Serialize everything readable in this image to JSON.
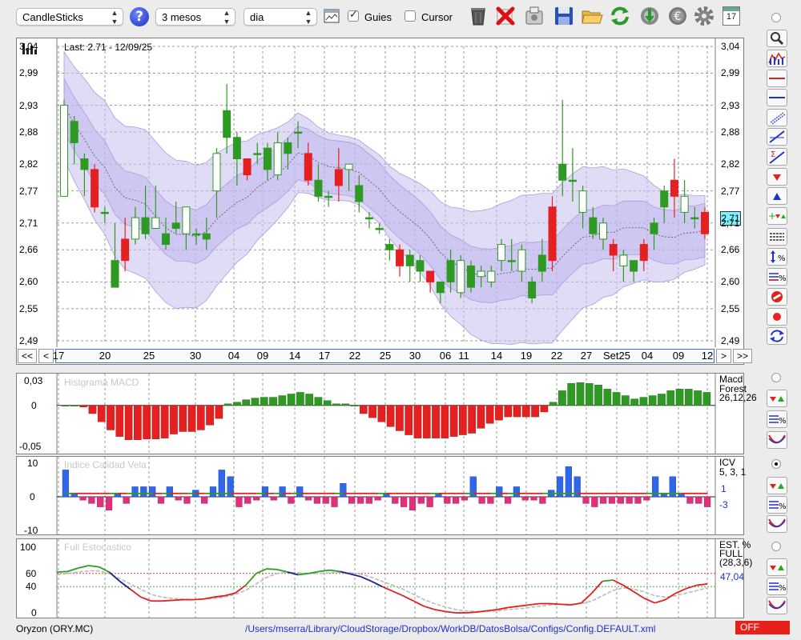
{
  "toolbar": {
    "chart_type": "CandleSticks",
    "period": "3 mesos",
    "interval": "dia",
    "guides_label": "Guies",
    "guides_checked": true,
    "cursor_label": "Cursor",
    "cursor_checked": false,
    "tools": [
      "help-icon",
      "window-icon",
      "trash-icon",
      "delete-x-icon",
      "ticker-tool-icon",
      "save-icon",
      "open-folder-icon",
      "refresh-icon",
      "download-icon",
      "currency-icon",
      "gear-icon",
      "calendar-icon"
    ],
    "calendar_day": "17"
  },
  "main_chart": {
    "last_label": "Last: 2.71 - 12/09/25",
    "current_price": "2,71",
    "y_ticks": [
      "3,04",
      "2,99",
      "2,93",
      "2,88",
      "2,82",
      "2,77",
      "2,71",
      "2,66",
      "2,60",
      "2,55",
      "2,49"
    ],
    "x_ticks": [
      "17",
      "20",
      "25",
      "30",
      "04",
      "09",
      "14",
      "17",
      "22",
      "25",
      "30",
      "06",
      "11",
      "14",
      "19",
      "22",
      "27",
      "Set25",
      "04",
      "09",
      "12"
    ],
    "nav": {
      "first": "<<",
      "prev": "<",
      "next": ">",
      "last": ">>"
    }
  },
  "macd": {
    "title": "Histgrama MACD",
    "y_ticks": [
      "0,03",
      "0",
      "-0,05"
    ],
    "label_line1": "Macd",
    "label_line2": "Forest",
    "label_line3": "26,12,26"
  },
  "icv": {
    "title": "Indice Calidad Vela",
    "y_ticks": [
      "10",
      "0",
      "-10"
    ],
    "label_line1": "ICV",
    "label_line2": "5, 3, 1",
    "value_pos": "1",
    "value_neg": "-3"
  },
  "stoch": {
    "title": "Full Estocastico",
    "y_ticks": [
      "100",
      "60",
      "40",
      "0"
    ],
    "label_line1": "EST. %",
    "label_line2": "FULL",
    "label_line3": "(28,3,6)",
    "value": "47,04"
  },
  "status": {
    "ticker": "Oryzon (ORY.MC)",
    "config_path": "/Users/mserra/Library/CloudStorage/Dropbox/WorkDB/DatosBolsa/Configs/Config.DEFAULT.xml",
    "off_label": "OFF"
  },
  "colors": {
    "up": "#2f9a23",
    "down": "#e52020",
    "band": "#c9c0ee",
    "accent": "#1f2fd0",
    "off_bg": "#e8201c"
  },
  "chart_data": [
    {
      "type": "candlestick",
      "y_range": [
        2.49,
        3.04
      ],
      "open": [
        2.76,
        2.9,
        2.83,
        2.81,
        2.73,
        2.64,
        2.68,
        2.68,
        2.72,
        2.7,
        2.69,
        2.71,
        2.69,
        2.69,
        2.69,
        2.77,
        2.92,
        2.87,
        2.83,
        2.84,
        2.85,
        2.8,
        2.86,
        2.88,
        2.84,
        2.79,
        2.76,
        2.81,
        2.81,
        2.78,
        2.72,
        2.7,
        2.67,
        2.66,
        2.65,
        2.64,
        2.62,
        2.6,
        2.64,
        2.58,
        2.63,
        2.61,
        2.6,
        2.64,
        2.64,
        2.62,
        2.6,
        2.65,
        2.74,
        2.82,
        2.79,
        2.73,
        2.72,
        2.68,
        2.67,
        2.63,
        2.64,
        2.67,
        2.71,
        2.77,
        2.79,
        2.73,
        2.72,
        2.73
      ],
      "close": [
        2.93,
        2.86,
        2.81,
        2.74,
        2.73,
        2.59,
        2.64,
        2.72,
        2.69,
        2.72,
        2.67,
        2.7,
        2.74,
        2.69,
        2.68,
        2.84,
        2.87,
        2.83,
        2.8,
        2.84,
        2.81,
        2.86,
        2.84,
        2.88,
        2.79,
        2.76,
        2.76,
        2.78,
        2.82,
        2.75,
        2.72,
        2.7,
        2.66,
        2.63,
        2.63,
        2.62,
        2.6,
        2.58,
        2.6,
        2.64,
        2.59,
        2.62,
        2.62,
        2.67,
        2.64,
        2.66,
        2.57,
        2.62,
        2.64,
        2.79,
        2.79,
        2.77,
        2.69,
        2.71,
        2.65,
        2.65,
        2.62,
        2.64,
        2.69,
        2.74,
        2.76,
        2.76,
        2.72,
        2.69
      ],
      "high": [
        2.94,
        2.91,
        2.84,
        2.82,
        2.74,
        2.71,
        2.72,
        2.74,
        2.78,
        2.78,
        2.72,
        2.75,
        2.74,
        2.7,
        2.72,
        2.85,
        2.97,
        2.88,
        2.83,
        2.86,
        2.86,
        2.88,
        2.87,
        2.9,
        2.86,
        2.82,
        2.77,
        2.85,
        2.82,
        2.8,
        2.73,
        2.71,
        2.68,
        2.67,
        2.66,
        2.65,
        2.62,
        2.6,
        2.66,
        2.65,
        2.64,
        2.63,
        2.63,
        2.68,
        2.68,
        2.67,
        2.61,
        2.68,
        2.76,
        2.94,
        2.85,
        2.78,
        2.74,
        2.72,
        2.68,
        2.66,
        2.64,
        2.68,
        2.72,
        2.78,
        2.83,
        2.79,
        2.74,
        2.74
      ],
      "low": [
        2.76,
        2.82,
        2.76,
        2.73,
        2.71,
        2.59,
        2.62,
        2.67,
        2.68,
        2.7,
        2.66,
        2.69,
        2.66,
        2.67,
        2.66,
        2.72,
        2.84,
        2.78,
        2.79,
        2.82,
        2.79,
        2.79,
        2.81,
        2.85,
        2.78,
        2.75,
        2.74,
        2.75,
        2.77,
        2.73,
        2.7,
        2.69,
        2.64,
        2.61,
        2.6,
        2.6,
        2.58,
        2.56,
        2.58,
        2.57,
        2.58,
        2.59,
        2.59,
        2.62,
        2.62,
        2.6,
        2.56,
        2.6,
        2.62,
        2.76,
        2.75,
        2.7,
        2.68,
        2.66,
        2.62,
        2.6,
        2.6,
        2.62,
        2.66,
        2.71,
        2.72,
        2.71,
        2.7,
        2.68
      ]
    },
    {
      "type": "bar",
      "name": "macd-histogram",
      "y_range": [
        -0.055,
        0.035
      ],
      "values": [
        0,
        0,
        -0.002,
        -0.01,
        -0.02,
        -0.03,
        -0.038,
        -0.042,
        -0.042,
        -0.041,
        -0.041,
        -0.04,
        -0.035,
        -0.032,
        -0.032,
        -0.03,
        -0.024,
        -0.016,
        0.002,
        0.004,
        0.007,
        0.009,
        0.01,
        0.01,
        0.012,
        0.014,
        0.016,
        0.014,
        0.01,
        0.006,
        0.002,
        0.002,
        0.0,
        -0.01,
        -0.015,
        -0.02,
        -0.026,
        -0.031,
        -0.036,
        -0.04,
        -0.04,
        -0.04,
        -0.04,
        -0.038,
        -0.036,
        -0.034,
        -0.028,
        -0.022,
        -0.018,
        -0.014,
        -0.014,
        -0.014,
        -0.014,
        -0.008,
        0.004,
        0.018,
        0.027,
        0.028,
        0.027,
        0.025,
        0.02,
        0.016,
        0.012,
        0.008,
        0.01,
        0.012,
        0.014,
        0.018,
        0.02,
        0.02,
        0.018,
        0.016
      ]
    },
    {
      "type": "bar",
      "name": "icv",
      "y_range": [
        -10,
        10
      ],
      "values": [
        8,
        1,
        -1,
        -2,
        -3,
        -4,
        1,
        -2,
        3,
        3,
        3,
        -2,
        3,
        -1,
        -2,
        2,
        -2,
        3,
        8,
        6,
        -3,
        -2,
        -1,
        3,
        -1,
        3,
        -2,
        3,
        -1,
        -2,
        -2,
        -3,
        4,
        -2,
        -2,
        -2,
        -1,
        1,
        -2,
        -3,
        -4,
        -2,
        -3,
        1,
        -2,
        -2,
        -1,
        6,
        -2,
        -2,
        3,
        -2,
        3,
        -1,
        -1,
        -2,
        2,
        6,
        9,
        6,
        -2,
        -3,
        -2,
        -2,
        -2,
        -2,
        -2,
        -1,
        6,
        1,
        6,
        1,
        -2,
        -2,
        -3
      ],
      "line": [
        1,
        1,
        1,
        1,
        1,
        1,
        1,
        1,
        1,
        1,
        1,
        1,
        1,
        1,
        1,
        1,
        1,
        1,
        1,
        1,
        1,
        1,
        1,
        1,
        1,
        1,
        1,
        1,
        1,
        1,
        1,
        1,
        1,
        1,
        1,
        1,
        1,
        1,
        1,
        1,
        1,
        1,
        1,
        1,
        1,
        1,
        1,
        1,
        1,
        1,
        1,
        1,
        1,
        1,
        1,
        1,
        1,
        1,
        1,
        1,
        1,
        1,
        1,
        1,
        1,
        1,
        1,
        1,
        1,
        1,
        1,
        1,
        1,
        1,
        1
      ]
    },
    {
      "type": "line",
      "name": "full-stochastic",
      "y_range": [
        0,
        100
      ],
      "levels": [
        60,
        40
      ],
      "k": [
        62,
        63,
        68,
        72,
        70,
        62,
        48,
        36,
        24,
        18,
        18,
        19,
        20,
        20,
        21,
        24,
        26,
        30,
        42,
        60,
        67,
        66,
        62,
        58,
        60,
        63,
        65,
        63,
        59,
        55,
        48,
        40,
        33,
        26,
        18,
        10,
        5,
        2,
        0,
        0,
        1,
        3,
        5,
        8,
        10,
        12,
        14,
        14,
        13,
        12,
        15,
        30,
        48,
        50,
        42,
        32,
        22,
        15,
        20,
        30,
        37,
        42,
        44
      ],
      "d": [
        58,
        60,
        62,
        64,
        64,
        60,
        52,
        44,
        36,
        28,
        24,
        22,
        21,
        20,
        21,
        22,
        24,
        28,
        34,
        44,
        54,
        60,
        62,
        61,
        60,
        60,
        61,
        62,
        61,
        59,
        54,
        48,
        42,
        36,
        28,
        20,
        14,
        9,
        5,
        3,
        2,
        2,
        3,
        5,
        6,
        8,
        10,
        12,
        13,
        13,
        14,
        18,
        26,
        34,
        38,
        36,
        32,
        26,
        24,
        26,
        30,
        34,
        38
      ]
    }
  ]
}
